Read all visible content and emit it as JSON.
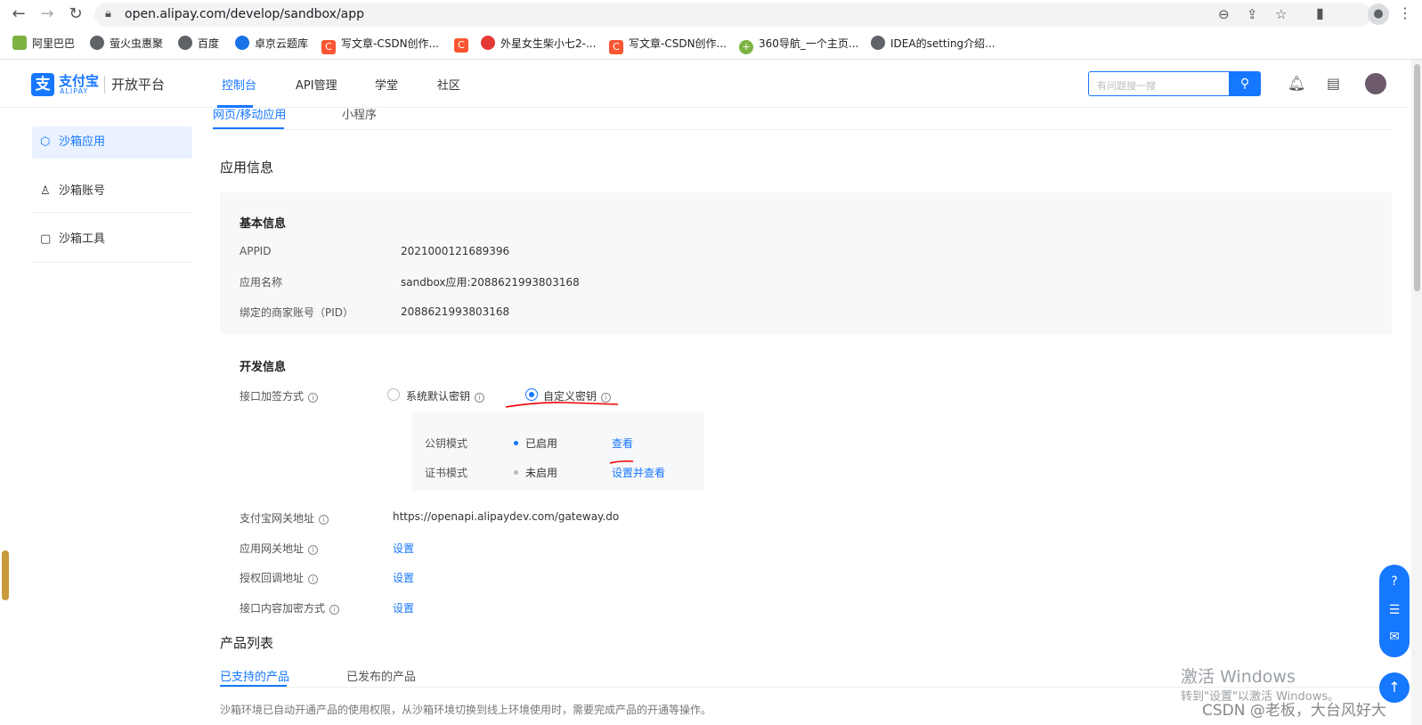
{
  "browser": {
    "url": "open.alipay.com/develop/sandbox/app",
    "bookmarks": [
      {
        "label": "阿里巴巴",
        "color": "#7cb342"
      },
      {
        "label": "萤火虫惠聚",
        "color": "#5f6368"
      },
      {
        "label": "百度",
        "color": "#5f6368"
      },
      {
        "label": "卓京云题库",
        "color": "#1a73e8"
      },
      {
        "label": "写文章-CSDN创作...",
        "color": "#fc5531"
      },
      {
        "label": "",
        "color": "#fc5531"
      },
      {
        "label": "外星女生柴小七2-...",
        "color": "#e53935"
      },
      {
        "label": "写文章-CSDN创作...",
        "color": "#fc5531"
      },
      {
        "label": "360导航_一个主页...",
        "color": "#7cb342"
      },
      {
        "label": "IDEA的setting介绍...",
        "color": "#5f6368"
      }
    ]
  },
  "header": {
    "logo_cn": "支付宝",
    "logo_en": "ALIPAY",
    "platform": "开放平台",
    "nav": [
      "控制台",
      "API管理",
      "学堂",
      "社区"
    ],
    "search_placeholder": "有问题搜一搜"
  },
  "sidebar": {
    "items": [
      {
        "label": "沙箱应用",
        "icon": "cube-icon"
      },
      {
        "label": "沙箱账号",
        "icon": "user-icon"
      },
      {
        "label": "沙箱工具",
        "icon": "tool-icon"
      }
    ]
  },
  "main": {
    "tabs": [
      "网页/移动应用",
      "小程序"
    ],
    "app_info_title": "应用信息",
    "basic_title": "基本信息",
    "basic": [
      {
        "label": "APPID",
        "value": "2021000121689396"
      },
      {
        "label": "应用名称",
        "value": "sandbox应用:2088621993803168"
      },
      {
        "label": "绑定的商家账号（PID）",
        "value": "2088621993803168"
      }
    ],
    "dev_title": "开发信息",
    "sign_label": "接口加签方式",
    "radio_default": "系统默认密钥",
    "radio_custom": "自定义密钥",
    "key_mode": {
      "label": "公钥模式",
      "status": "已启用",
      "action": "查看"
    },
    "cert_mode": {
      "label": "证书模式",
      "status": "未启用",
      "action": "设置并查看"
    },
    "gateway_label": "支付宝网关地址",
    "gateway_value": "https://openapi.alipaydev.com/gateway.do",
    "app_gateway_label": "应用网关地址",
    "app_gateway_action": "设置",
    "callback_label": "授权回调地址",
    "callback_action": "设置",
    "encrypt_label": "接口内容加密方式",
    "encrypt_action": "设置",
    "product_title": "产品列表",
    "product_tabs": [
      "已支持的产品",
      "已发布的产品"
    ],
    "product_note": "沙箱环境已自动开通产品的使用权限，从沙箱环境切换到线上环境使用时，需要完成产品的开通等操作。"
  },
  "watermark": {
    "line1": "激活 Windows",
    "line2": "转到\"设置\"以激活 Windows。",
    "csdn": "CSDN @老板，大台风好大"
  }
}
